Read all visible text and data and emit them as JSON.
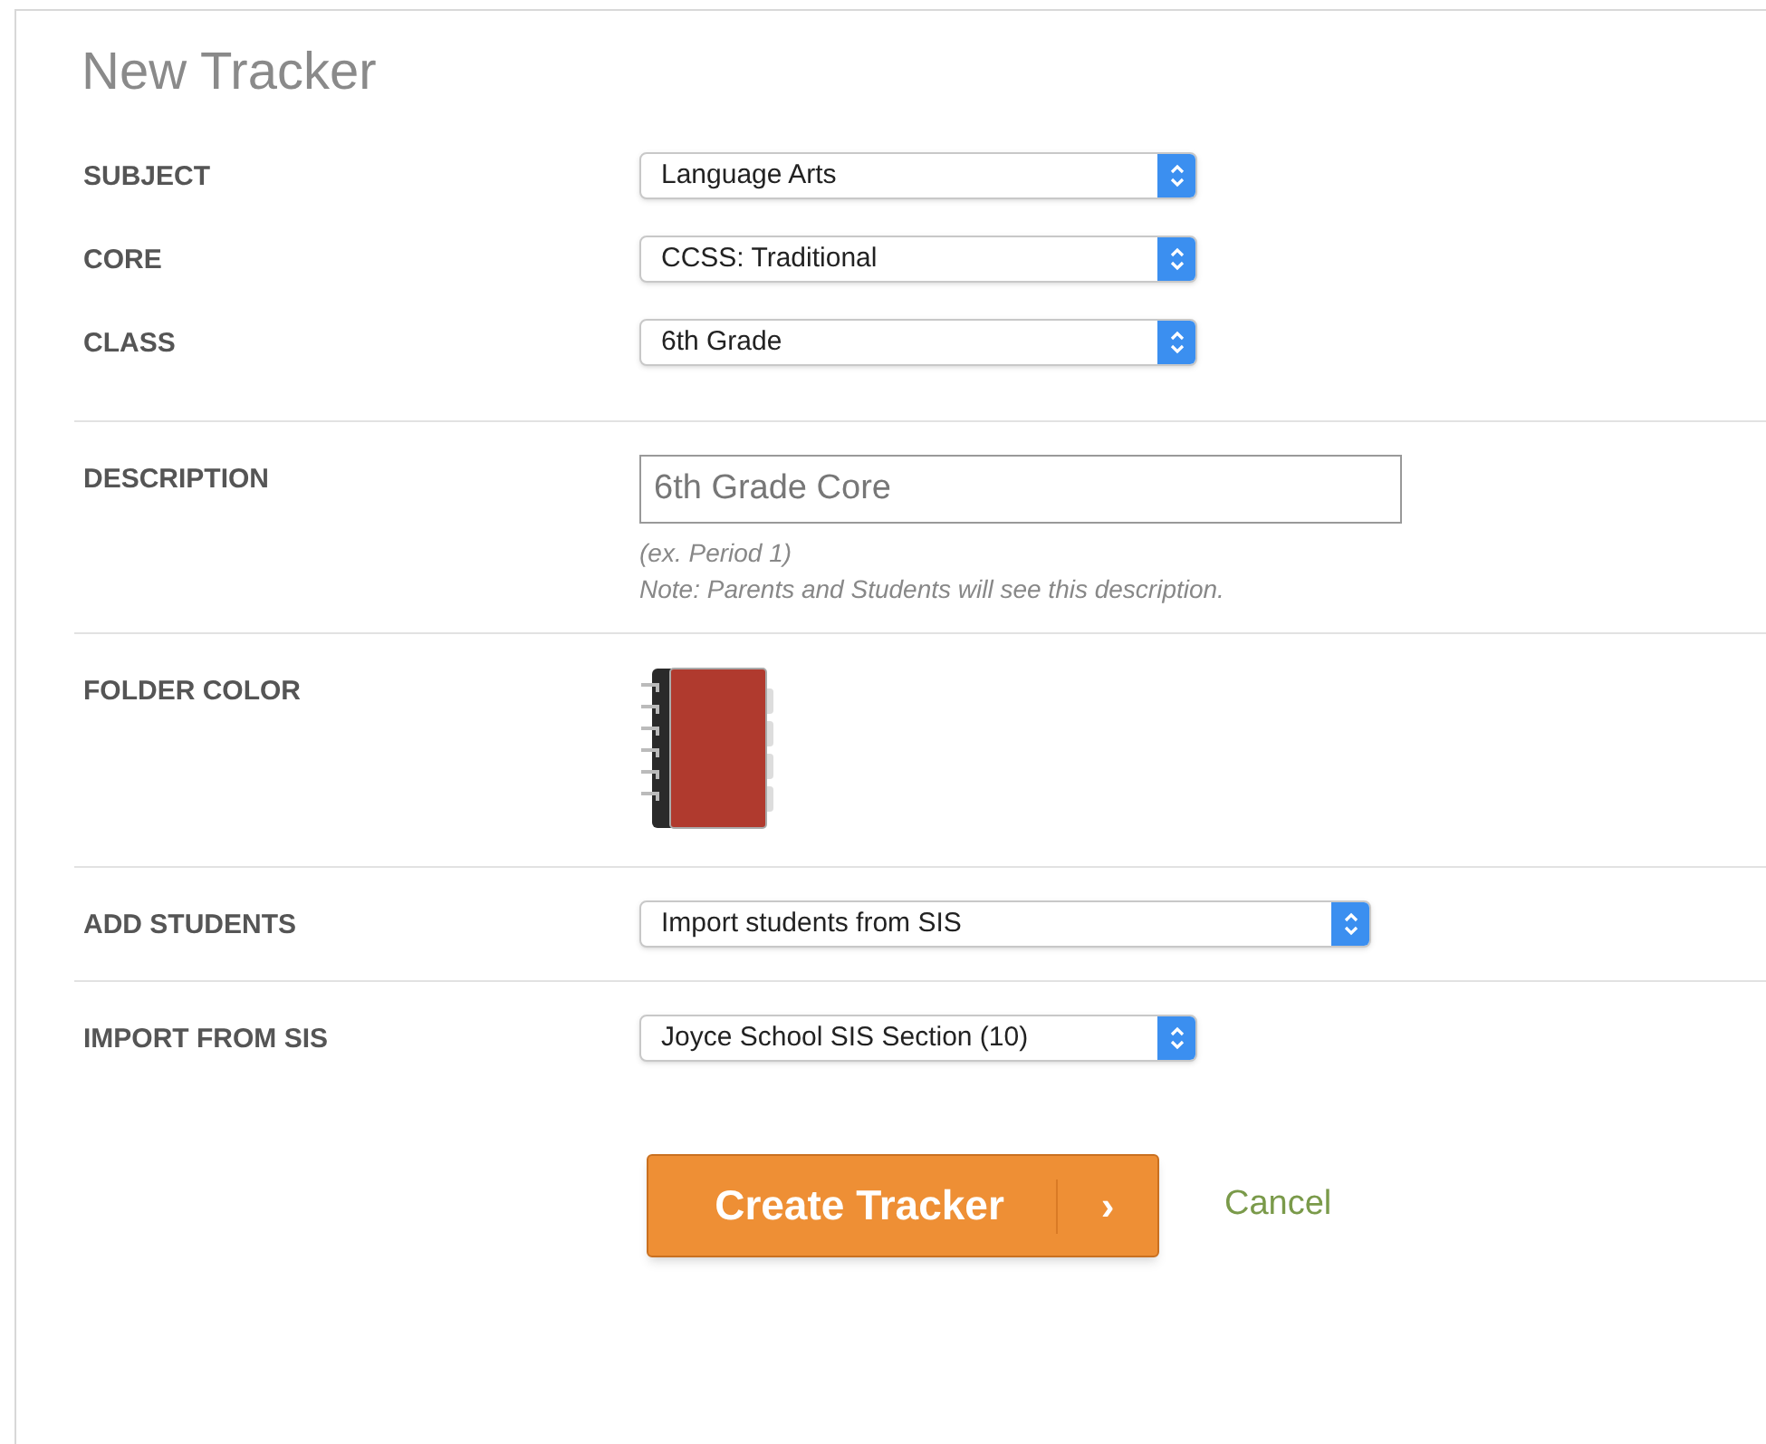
{
  "title": "New Tracker",
  "sections": [
    {
      "fields": [
        {
          "kind": "select",
          "label": "SUBJECT",
          "value": "Language Arts"
        },
        {
          "kind": "select",
          "label": "CORE",
          "value": "CCSS: Traditional"
        },
        {
          "kind": "select",
          "label": "CLASS",
          "value": "6th Grade"
        }
      ]
    },
    {
      "fields": [
        {
          "kind": "text",
          "label": "DESCRIPTION",
          "placeholder": "6th Grade Core",
          "hints": [
            "(ex. Period 1)",
            "Note: Parents and Students will see this description."
          ]
        }
      ]
    },
    {
      "fields": [
        {
          "kind": "folder",
          "label": "FOLDER COLOR",
          "color": "#b03a2e"
        }
      ]
    },
    {
      "fields": [
        {
          "kind": "wide_select",
          "label": "ADD STUDENTS",
          "value": "Import students from SIS"
        }
      ]
    },
    {
      "fields": [
        {
          "kind": "select",
          "label": "IMPORT FROM SIS",
          "value": "Joyce School SIS Section (10)"
        }
      ]
    }
  ],
  "actions": {
    "submit": "Create Tracker",
    "submit_arrow": "›",
    "cancel": "Cancel"
  }
}
